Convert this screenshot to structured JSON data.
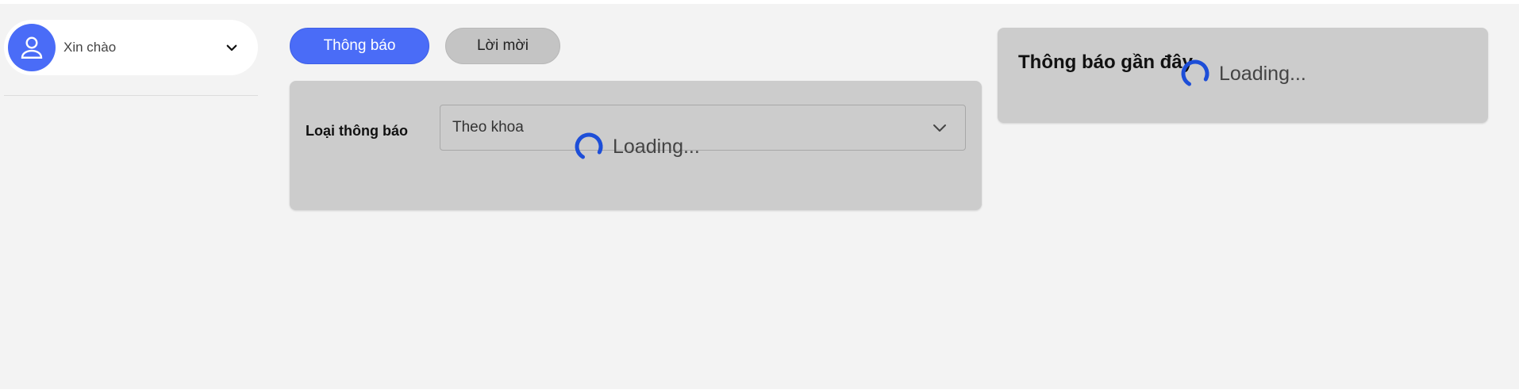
{
  "user": {
    "greeting": "Xin chào",
    "avatar_icon": "user-icon",
    "dropdown_icon": "chevron-down-icon"
  },
  "tabs": [
    {
      "label": "Thông báo",
      "active": true
    },
    {
      "label": "Lời mời",
      "active": false
    }
  ],
  "filter": {
    "label": "Loại thông báo",
    "select_value": "Theo khoa",
    "loading_text": "Loading..."
  },
  "recent": {
    "title": "Thông báo gần đây",
    "loading_text": "Loading..."
  },
  "colors": {
    "accent": "#4a6cf7",
    "spinner": "#1d4ed8",
    "background": "#f3f3f3",
    "panel": "#cccccc"
  }
}
